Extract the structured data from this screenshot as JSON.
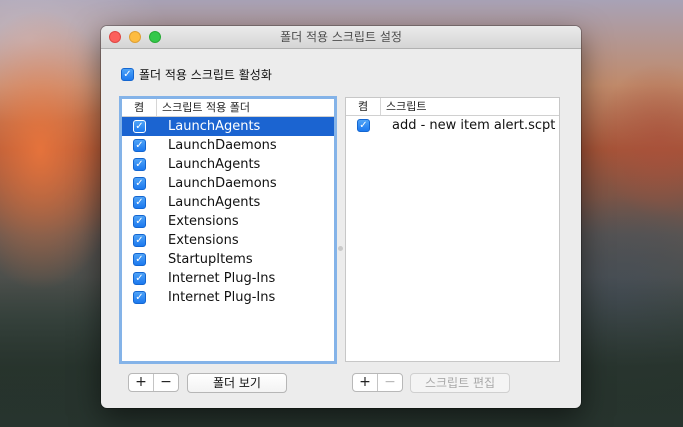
{
  "window": {
    "title": "폴더 적용 스크립트 설정"
  },
  "enable_checkbox": {
    "label": "폴더 적용 스크립트 활성화",
    "checked": true
  },
  "folders": {
    "header": {
      "col_enabled": "켬",
      "col_name": "스크립트 적용 폴더"
    },
    "rows": [
      {
        "name": "LaunchAgents",
        "checked": true,
        "selected": true
      },
      {
        "name": "LaunchDaemons",
        "checked": true
      },
      {
        "name": "LaunchAgents",
        "checked": true
      },
      {
        "name": "LaunchDaemons",
        "checked": true
      },
      {
        "name": "LaunchAgents",
        "checked": true
      },
      {
        "name": "Extensions",
        "checked": true
      },
      {
        "name": "Extensions",
        "checked": true
      },
      {
        "name": "StartupItems",
        "checked": true
      },
      {
        "name": "Internet Plug-Ins",
        "checked": true
      },
      {
        "name": "Internet Plug-Ins",
        "checked": true
      }
    ],
    "add_label": "+",
    "remove_label": "−",
    "show_folder_label": "폴더 보기"
  },
  "scripts": {
    "header": {
      "col_enabled": "켬",
      "col_name": "스크립트"
    },
    "rows": [
      {
        "name": "add - new item alert.scpt",
        "checked": true
      }
    ],
    "add_label": "+",
    "remove_label": "−",
    "edit_script_label": "스크립트 편집"
  },
  "check_glyph": "✓",
  "colors": {
    "selection": "#1b64d1",
    "checkbox": "#1c79ef",
    "focus_ring": "#84b3e8"
  }
}
